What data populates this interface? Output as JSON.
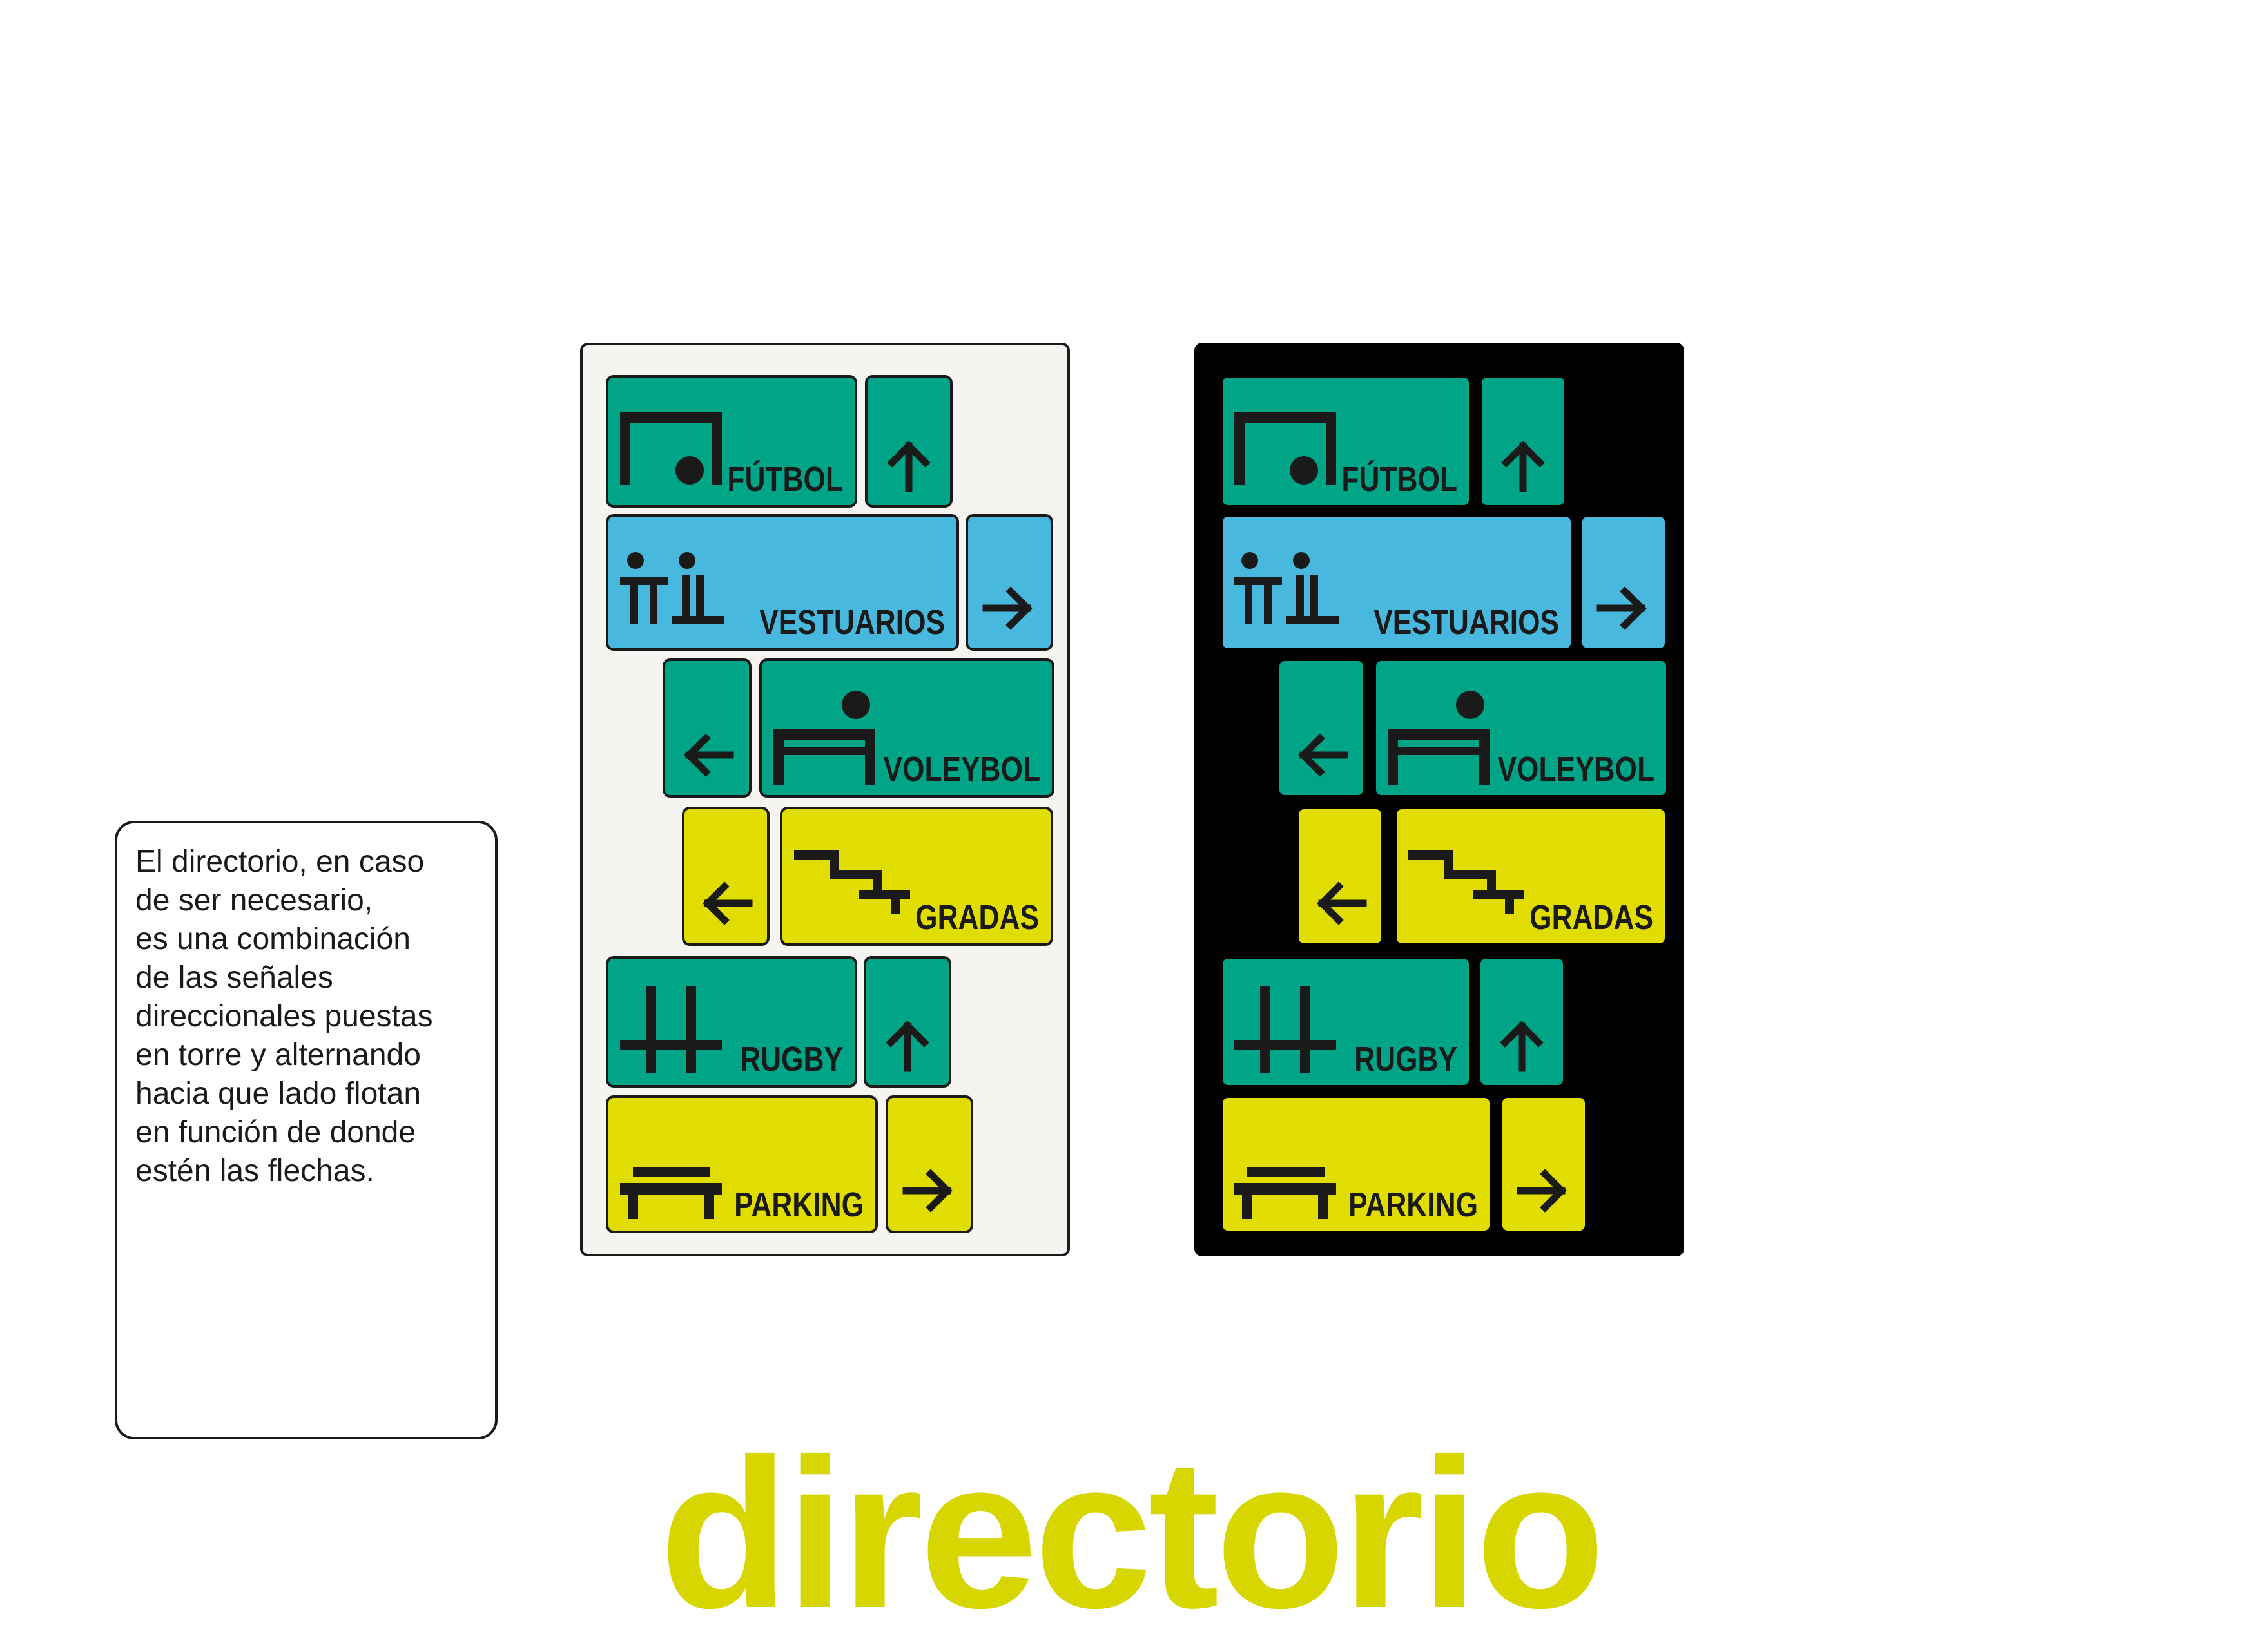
{
  "note": {
    "text": "El directorio, en caso\nde ser necesario,\nes una combinación\nde las señales\ndireccionales puestas\nen torre y alternando\nhacia que lado flotan\nen función de donde\nestén las flechas."
  },
  "colors": {
    "green": "#00a587",
    "blue": "#48b8df",
    "yellow": "#e1dd00",
    "ink": "#1a1a1a",
    "light_board": "#f5f4f0",
    "dark_board": "#000000",
    "title": "#d8d600"
  },
  "boards": [
    {
      "variant": "light",
      "background": "#f5f4f0"
    },
    {
      "variant": "dark",
      "background": "#000000"
    }
  ],
  "signs": [
    {
      "label": "FÚTBOL",
      "icon": "goal-icon",
      "arrow": "arrow-up-icon",
      "color": "green"
    },
    {
      "label": "VESTUARIOS",
      "icon": "changing-room-icon",
      "arrow": "arrow-right-icon",
      "color": "blue"
    },
    {
      "label": "VOLEYBOL",
      "icon": "volleyball-player-icon",
      "arrow": "arrow-left-icon",
      "color": "green"
    },
    {
      "label": "GRADAS",
      "icon": "stairs-icon",
      "arrow": "arrow-left-icon",
      "color": "yellow"
    },
    {
      "label": "RUGBY",
      "icon": "rugby-posts-icon",
      "arrow": "arrow-up-icon",
      "color": "green"
    },
    {
      "label": "PARKING",
      "icon": "bench-icon",
      "arrow": "arrow-right-icon",
      "color": "yellow"
    }
  ],
  "title": "directorio"
}
